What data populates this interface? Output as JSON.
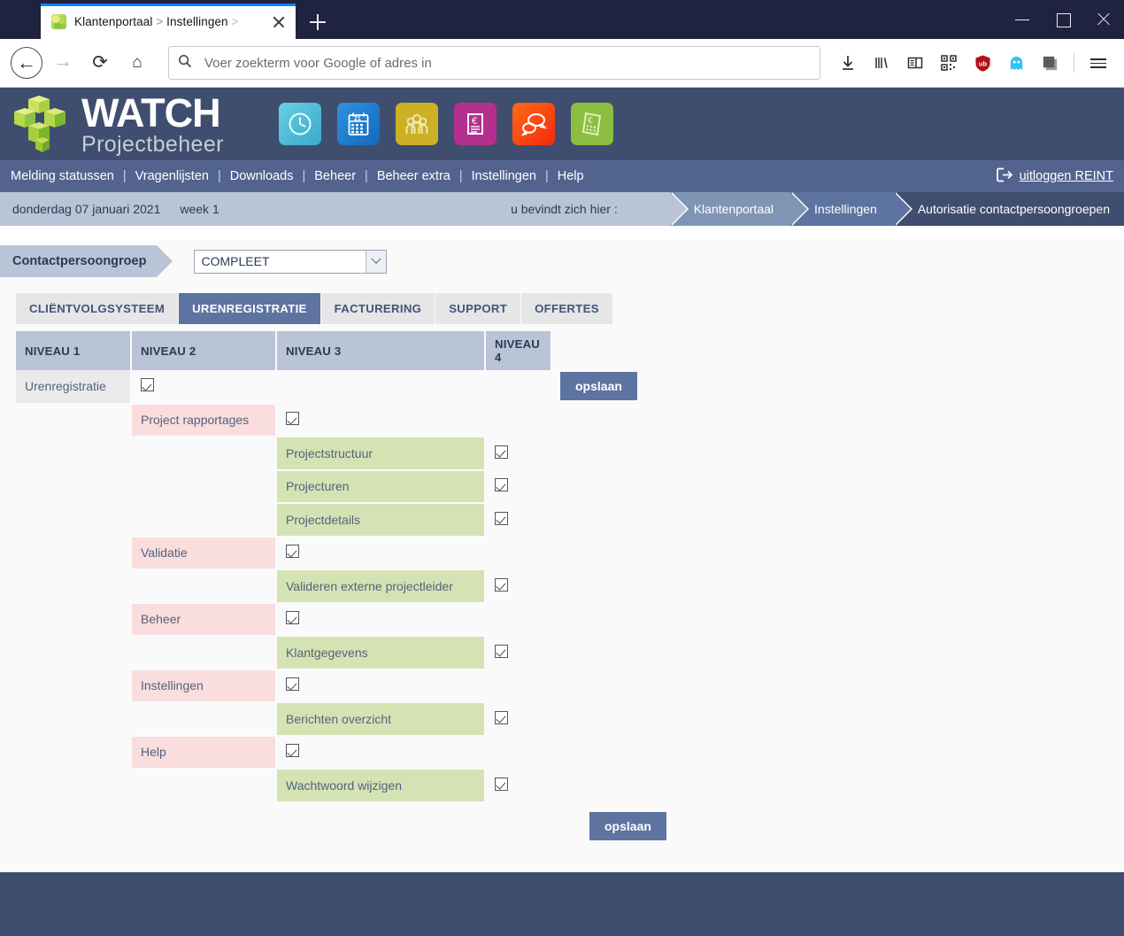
{
  "browser": {
    "tab": {
      "title_main": "Klantenportaal",
      "sep1": ">",
      "title_sub": "Instellingen",
      "sep2": ">",
      "favicon": "watch-favicon",
      "close_icon": "close-icon",
      "newtab_icon": "plus-icon"
    },
    "window_controls": {
      "minimize": "minimize-icon",
      "maximize": "maximize-icon",
      "close": "close-icon"
    },
    "nav": {
      "back": "back-arrow-icon",
      "forward": "forward-arrow-icon",
      "reload": "reload-icon",
      "home": "home-icon"
    },
    "urlbar": {
      "placeholder": "Voer zoekterm voor Google of adres in",
      "value": "",
      "search_icon": "search-icon"
    },
    "toolbar_icons": [
      "downloads-icon",
      "library-icon",
      "sidebar-icon",
      "qr-code-icon",
      "ublock-origin-icon",
      "ghostery-icon",
      "extension-square-icon"
    ],
    "menu_icon": "hamburger-menu-icon"
  },
  "app": {
    "logo": {
      "word1": "WATCH",
      "word2": "Projectbeheer",
      "mark": "cube-logo-icon"
    },
    "header_icons": [
      {
        "name": "clock-icon",
        "color": "#4bbdd6",
        "glyph": "clock"
      },
      {
        "name": "calendar-icon",
        "color": "#1e7fd4",
        "glyph": "21"
      },
      {
        "name": "people-icon",
        "color": "#cdb024",
        "glyph": "people"
      },
      {
        "name": "invoice-euro-icon",
        "color": "#b3308f",
        "glyph": "document-euro"
      },
      {
        "name": "chat-icon",
        "color": "#f4511e",
        "glyph": "speech-bubbles"
      },
      {
        "name": "calculator-euro-icon",
        "color": "#8cbf3f",
        "glyph": "calculator-euro"
      }
    ],
    "menu": {
      "items": [
        "Melding statussen",
        "Vragenlijsten",
        "Downloads",
        "Beheer",
        "Beheer extra",
        "Instellingen",
        "Help"
      ],
      "separator": "|",
      "logout_label": "uitloggen REINT",
      "logout_icon": "logout-icon"
    },
    "breadcrumb": {
      "date": "donderdag 07 januari 2021",
      "week": "week 1",
      "here_label": "u bevindt zich hier :",
      "crumbs": [
        "Klantenportaal",
        "Instellingen",
        "Autorisatie contactpersoongroepen"
      ]
    },
    "group": {
      "label": "Contactpersoongroep",
      "selected": "COMPLEET",
      "options": [
        "COMPLEET"
      ]
    },
    "tabs": [
      {
        "label": "CLIËNTVOLGSYSTEEM",
        "active": false
      },
      {
        "label": "URENREGISTRATIE",
        "active": true
      },
      {
        "label": "FACTURERING",
        "active": false
      },
      {
        "label": "SUPPORT",
        "active": false
      },
      {
        "label": "OFFERTES",
        "active": false
      }
    ],
    "table": {
      "headers": [
        "NIVEAU 1",
        "NIVEAU 2",
        "NIVEAU 3",
        "NIVEAU 4"
      ],
      "rows": [
        {
          "level": 1,
          "label": "Urenregistratie",
          "checked": true,
          "save_button": true
        },
        {
          "level": 2,
          "label": "Project rapportages",
          "checked": true
        },
        {
          "level": 3,
          "label": "Projectstructuur",
          "checked": true
        },
        {
          "level": 3,
          "label": "Projecturen",
          "checked": true
        },
        {
          "level": 3,
          "label": "Projectdetails",
          "checked": true
        },
        {
          "level": 2,
          "label": "Validatie",
          "checked": true
        },
        {
          "level": 3,
          "label": "Valideren externe projectleider",
          "checked": true
        },
        {
          "level": 2,
          "label": "Beheer",
          "checked": true
        },
        {
          "level": 3,
          "label": "Klantgegevens",
          "checked": true
        },
        {
          "level": 2,
          "label": "Instellingen",
          "checked": true
        },
        {
          "level": 3,
          "label": "Berichten overzicht",
          "checked": true
        },
        {
          "level": 2,
          "label": "Help",
          "checked": true
        },
        {
          "level": 3,
          "label": "Wachtwoord wijzigen",
          "checked": true
        }
      ],
      "save_label": "opslaan"
    },
    "colors": {
      "header_dark": "#3f4e6e",
      "menu_blue": "#52648e",
      "breadcrumb_light": "#b9c5d6",
      "accent": "#5d73a0",
      "level1_bg": "#eaeaea",
      "level2_bg": "#fadddd",
      "level3_bg": "#d5e3b4"
    }
  }
}
